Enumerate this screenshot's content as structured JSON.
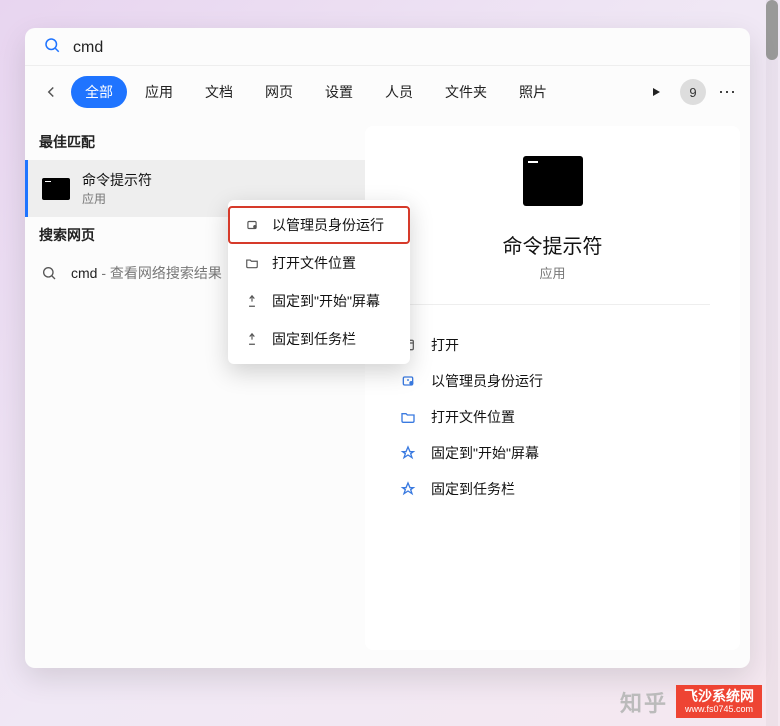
{
  "search": {
    "query": "cmd"
  },
  "tabs": {
    "items": [
      "全部",
      "应用",
      "文档",
      "网页",
      "设置",
      "人员",
      "文件夹",
      "照片"
    ],
    "active_index": 0,
    "badge": "9"
  },
  "left": {
    "best_match_label": "最佳匹配",
    "result": {
      "title": "命令提示符",
      "subtitle": "应用"
    },
    "web_label": "搜索网页",
    "web_item": {
      "query": "cmd",
      "suffix": " - 查看网络搜索结果"
    }
  },
  "context_menu": {
    "items": [
      {
        "icon": "admin",
        "label": "以管理员身份运行",
        "highlight": true
      },
      {
        "icon": "folder",
        "label": "打开文件位置"
      },
      {
        "icon": "pin",
        "label": "固定到\"开始\"屏幕"
      },
      {
        "icon": "pin",
        "label": "固定到任务栏"
      }
    ]
  },
  "preview": {
    "title": "命令提示符",
    "subtitle": "应用",
    "actions": [
      {
        "icon": "open",
        "label": "打开"
      },
      {
        "icon": "admin",
        "label": "以管理员身份运行"
      },
      {
        "icon": "folder",
        "label": "打开文件位置"
      },
      {
        "icon": "pin",
        "label": "固定到\"开始\"屏幕"
      },
      {
        "icon": "pin",
        "label": "固定到任务栏"
      }
    ]
  },
  "watermark": {
    "zhihu": "知乎",
    "brand": "飞沙系统网",
    "url": "www.fs0745.com"
  },
  "colors": {
    "accent": "#1f74ff",
    "highlight_border": "#d63a2a"
  }
}
